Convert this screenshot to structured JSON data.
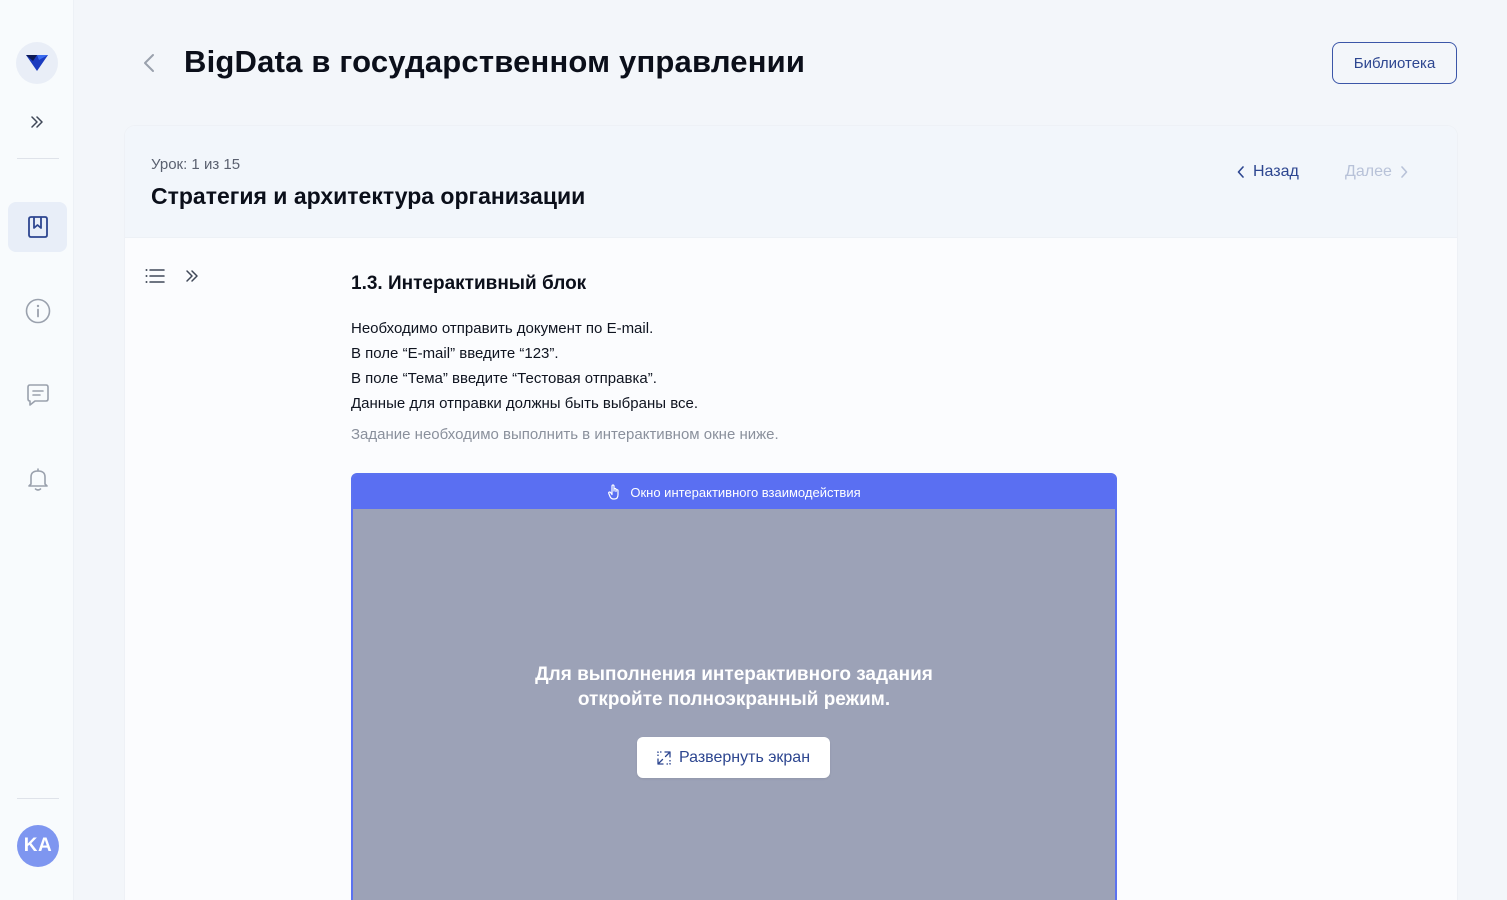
{
  "header": {
    "title": "BigData в государственном управлении",
    "library_label": "Библиотека"
  },
  "sidebar": {
    "items": [
      {
        "name": "courses",
        "icon": "book-bookmark-icon",
        "active": true
      },
      {
        "name": "info",
        "icon": "info-icon",
        "active": false
      },
      {
        "name": "messages",
        "icon": "chat-icon",
        "active": false
      },
      {
        "name": "notifications",
        "icon": "bell-icon",
        "active": false
      }
    ],
    "avatar_initials": "KA"
  },
  "lesson": {
    "counter": "Урок: 1 из 15",
    "title": "Стратегия и архитектура организации",
    "prev_label": "Назад",
    "next_label": "Далее",
    "next_enabled": false
  },
  "content": {
    "block_title": "1.3. Интерактивный блок",
    "instructions": [
      "Необходимо отправить документ по E-mail.",
      "В поле “E-mail” введите “123”.",
      "В поле “Тема” введите “Тестовая отправка”.",
      "Данные для отправки должны быть выбраны все."
    ],
    "hint": "Задание необходимо выполнить в интерактивном окне ниже."
  },
  "interactive_window": {
    "header_label": "Окно интерактивного взаимодействия",
    "message_line1": "Для выполнения интерактивного задания",
    "message_line2": "откройте полноэкранный режим.",
    "expand_label": "Развернуть экран"
  },
  "colors": {
    "accent": "#5a6ff2",
    "primary_text": "#2d4690",
    "avatar": "#7e96f0",
    "overlay": "#9ca2b7"
  }
}
